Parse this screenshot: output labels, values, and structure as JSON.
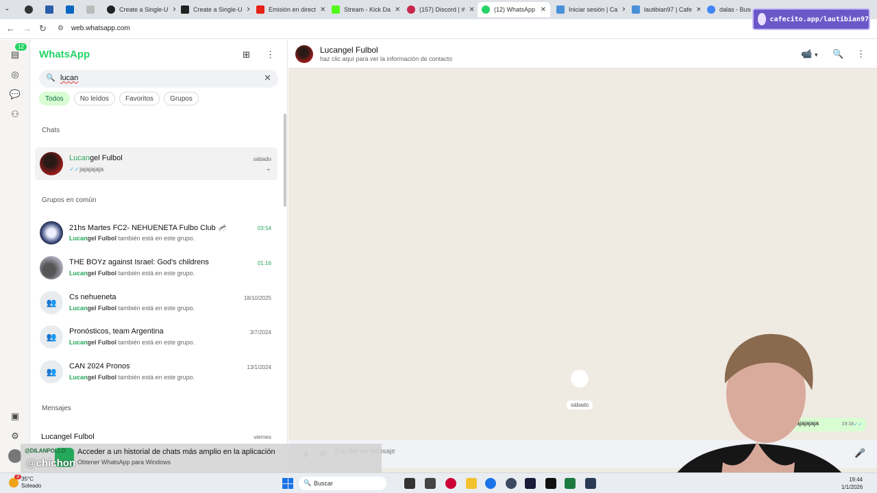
{
  "browser": {
    "tabs": [
      {
        "label": "",
        "icon": "github-icon",
        "color": "#333333"
      },
      {
        "label": "",
        "icon": "generic-page-icon",
        "color": "#2b5dab"
      },
      {
        "label": "",
        "icon": "linkedin-icon",
        "color": "#0a66c2"
      },
      {
        "label": "",
        "icon": "info-icon",
        "color": "#888888"
      },
      {
        "label": "Create a Single-U",
        "icon": "github-icon",
        "color": "#222222"
      },
      {
        "label": "Create a Single-U",
        "icon": "terminal-icon",
        "color": "#222222"
      },
      {
        "label": "Emisión en direct",
        "icon": "youtube-icon",
        "color": "#e62117"
      },
      {
        "label": "Stream - Kick Da",
        "icon": "kick-icon",
        "color": "#53fc18"
      },
      {
        "label": "(157) Discord | #",
        "icon": "discord-icon",
        "color": "#c8294c"
      },
      {
        "label": "(12) WhatsApp",
        "icon": "whatsapp-icon",
        "color": "#25d366"
      },
      {
        "label": "Iniciar sesión | Ca",
        "icon": "generic-page-icon",
        "color": "#4a90d9"
      },
      {
        "label": "lautibian97 | Cafe",
        "icon": "generic-page-icon",
        "color": "#4a90d9"
      },
      {
        "label": "dalas - Buscar",
        "icon": "google-icon",
        "color": "#4285f4"
      }
    ],
    "url": "web.whatsapp.com"
  },
  "overlay": {
    "badge": "cafecito.app/lautibian97"
  },
  "rail": {
    "unread_badge": "12"
  },
  "sidebar": {
    "title": "WhatsApp",
    "search_value": "lucan",
    "filters": [
      "Todos",
      "No leídos",
      "Favoritos",
      "Grupos"
    ],
    "sections": {
      "chats": "Chats",
      "groups": "Grupos en común",
      "messages": "Mensajes"
    },
    "chats": [
      {
        "name_hl": "Lucan",
        "name_rest": "gel Fulbol",
        "preview": "jajajajaja",
        "time": "sábado",
        "tick": "✓✓"
      }
    ],
    "groups_common_suffix": "también está en este grupo.",
    "member_hl": "Lucan",
    "member_rest": "gel Fulbol",
    "groups": [
      {
        "name": "21hs Martes FC2- NEHUENETA Fulbo Club 🦟",
        "time": "03:54",
        "time_green": true
      },
      {
        "name": "THE BOYz against Israel: God's childrens",
        "time": "01:16",
        "time_green": true
      },
      {
        "name": "Cs nehueneta",
        "time": "18/10/2025",
        "time_green": false
      },
      {
        "name": "Pronósticos, team Argentina",
        "time": "3/7/2024",
        "time_green": false
      },
      {
        "name": "CAN 2024 Pronos",
        "time": "13/1/2024",
        "time_green": false
      }
    ],
    "message_row": {
      "name": "Lucangel Fulbol",
      "time": "viernes"
    }
  },
  "chat": {
    "name": "Lucangel Fulbol",
    "subtitle": "haz clic aquí para ver la información de contacto",
    "date_pill": "sábado",
    "last_message": "jajajajaja",
    "last_time": "19:18",
    "composer_placeholder": "Escribe un mensaje"
  },
  "promo": {
    "line1": "Acceder a un historial de chats más amplio en la aplicación",
    "line2": "Obtener WhatsApp para Windows",
    "handle_small": "@DILANPOLLO",
    "handle_big": "@chichon"
  },
  "taskbar": {
    "weather_temp": "35°C",
    "weather_desc": "Soleado",
    "search": "Buscar",
    "time": "19:44",
    "date": "1/1/2026",
    "notif": "3"
  }
}
